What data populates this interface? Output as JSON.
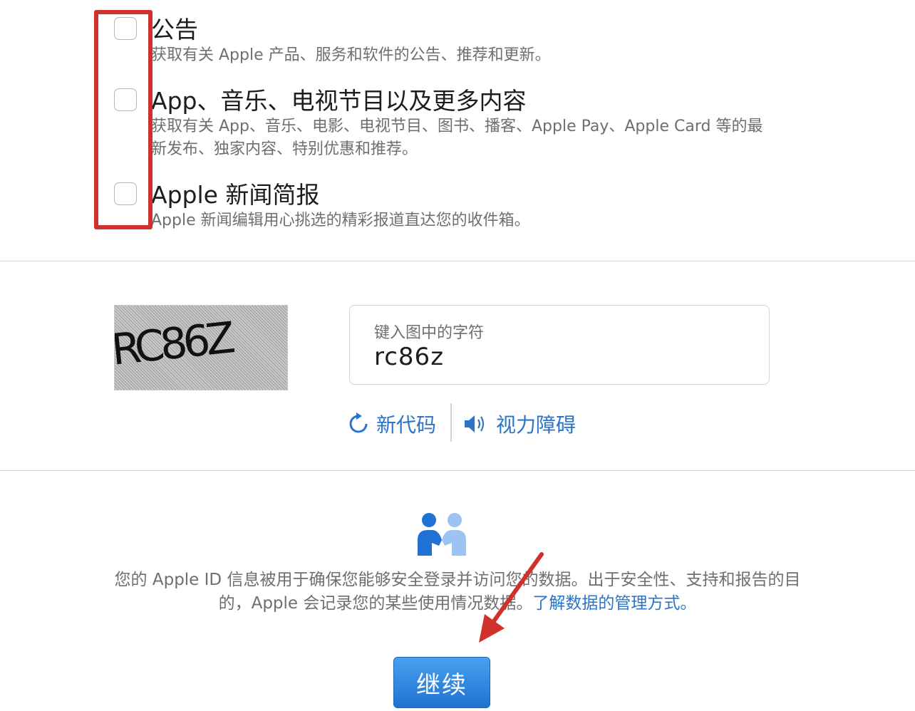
{
  "subscriptions": [
    {
      "title": "公告",
      "description": "获取有关 Apple 产品、服务和软件的公告、推荐和更新。",
      "checked": false
    },
    {
      "title": "App、音乐、电视节目以及更多内容",
      "description": "获取有关 App、音乐、电影、电视节目、图书、播客、Apple Pay、Apple Card 等的最新发布、独家内容、特别优惠和推荐。",
      "checked": false
    },
    {
      "title": "Apple 新闻简报",
      "description": "Apple 新闻编辑用心挑选的精彩报道直达您的收件箱。",
      "checked": false
    }
  ],
  "captcha": {
    "image_text": "RC86Z",
    "field_label": "键入图中的字符",
    "field_value": "rc86z",
    "new_code_label": "新代码",
    "accessibility_label": "视力障碍"
  },
  "privacy": {
    "text": "您的 Apple ID 信息被用于确保您能够安全登录并访问您的数据。出于安全性、支持和报告的目的，Apple 会记录您的某些使用情况数据。",
    "link_text": "了解数据的管理方式。"
  },
  "continue_label": "继续",
  "colors": {
    "link": "#2a75c9",
    "button": "#1f72d3",
    "highlight": "#d0312d",
    "text_secondary": "#6e6e73"
  },
  "icons": [
    "refresh-icon",
    "speaker-icon",
    "people-icon"
  ]
}
